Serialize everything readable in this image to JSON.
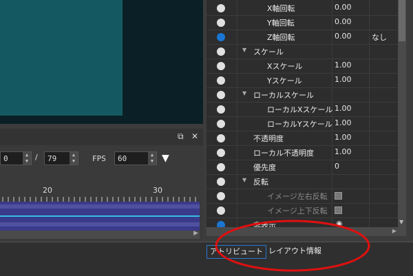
{
  "timeline": {
    "frame_value": "0",
    "separator": "/",
    "total_frames": "79",
    "fps_label": "FPS",
    "fps_value": "60",
    "ruler_labels": [
      "20",
      "30"
    ]
  },
  "properties": {
    "rows": [
      {
        "label": "X軸回転",
        "value": "0.00",
        "extra": "",
        "radio": "off",
        "indent": 2
      },
      {
        "label": "Y軸回転",
        "value": "0.00",
        "extra": "",
        "radio": "off",
        "indent": 2
      },
      {
        "label": "Z軸回転",
        "value": "0.00",
        "extra": "なし",
        "radio": "on",
        "indent": 2
      },
      {
        "label": "スケール",
        "value": "",
        "extra": "",
        "radio": "off",
        "indent": 0,
        "group": true
      },
      {
        "label": "Xスケール",
        "value": "1.00",
        "extra": "",
        "radio": "off",
        "indent": 2
      },
      {
        "label": "Yスケール",
        "value": "1.00",
        "extra": "",
        "radio": "off",
        "indent": 2
      },
      {
        "label": "ローカルスケール",
        "value": "",
        "extra": "",
        "radio": "off",
        "indent": 0,
        "group": true
      },
      {
        "label": "ローカルXスケール",
        "value": "1.00",
        "extra": "",
        "radio": "off",
        "indent": 2
      },
      {
        "label": "ローカルYスケール",
        "value": "1.00",
        "extra": "",
        "radio": "off",
        "indent": 2
      },
      {
        "label": "不透明度",
        "value": "1.00",
        "extra": "",
        "radio": "off",
        "indent": 1
      },
      {
        "label": "ローカル不透明度",
        "value": "1.00",
        "extra": "",
        "radio": "off",
        "indent": 1
      },
      {
        "label": "優先度",
        "value": "0",
        "extra": "",
        "radio": "off",
        "indent": 1
      },
      {
        "label": "反転",
        "value": "",
        "extra": "",
        "radio": "off",
        "indent": 0,
        "group": true
      },
      {
        "label": "イメージ左右反転",
        "value": "",
        "extra": "",
        "radio": "off",
        "indent": 2,
        "disabled": true,
        "checkbox": true
      },
      {
        "label": "イメージ上下反転",
        "value": "",
        "extra": "",
        "radio": "off",
        "indent": 2,
        "disabled": true,
        "checkbox": true
      },
      {
        "label": "非表示",
        "value": "",
        "extra": "",
        "radio": "on",
        "indent": 1,
        "eye": true
      }
    ]
  },
  "tabs": {
    "attribute": "アトリビュート",
    "layout": "レイアウト情報"
  },
  "colors": {
    "accent": "#1a76d2",
    "track": "#3a3a8a",
    "track_line": "#34c0e8",
    "annotation": "#e01010"
  }
}
